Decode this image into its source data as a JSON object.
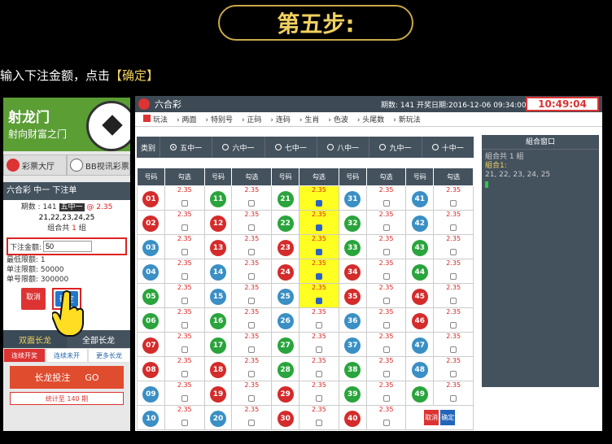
{
  "banner": {
    "title": "第五步:"
  },
  "instruction": {
    "prefix": "输入下注金额，点击",
    "highlight": "【确定】"
  },
  "left": {
    "brand": "射龙门",
    "slogan": "射向财富之门",
    "nav": [
      {
        "label": "彩票大厅"
      },
      {
        "label": "BB视讯彩票"
      }
    ],
    "bet_title": "六合彩 中一 下注单",
    "period_label": "期数 : 141",
    "tag": "五中一",
    "odds": "@ 2.35",
    "numbers": "21,22,23,24,25",
    "combo_prefix": "组合共",
    "combo_count": "1",
    "combo_suffix": "组",
    "amount_label": "下注金额:",
    "amount_value": "50",
    "min_bet": "最低限额: 1",
    "single_limit": "单注限额: 50000",
    "single_number_limit": "单号限额: 300000",
    "cancel": "取消",
    "confirm": "确定",
    "dragon_tabs": [
      "双面长龙",
      "全部长龙"
    ],
    "dragon_sub": [
      "连续开奖",
      "连续未开",
      "更多长龙"
    ],
    "dragon_bet": "长龙投注",
    "dragon_go": "GO",
    "stats": "统计至 140 期"
  },
  "main": {
    "title": "六合彩",
    "period": "期数: 141",
    "open_date": "开奖日期:2016-12-06 09:34:00",
    "timer": "10:49:04",
    "play_items": [
      "玩法",
      "两面",
      "特别号",
      "正码",
      "连码",
      "生肖",
      "色波",
      "头尾数",
      "新玩法"
    ],
    "category_label": "类别",
    "categories": [
      "五中一",
      "六中一",
      "七中一",
      "八中一",
      "九中一",
      "十中一"
    ],
    "col_num": "号码",
    "col_pick": "勾选",
    "odds": "2.35",
    "cancel": "取消",
    "confirm": "确定",
    "colors": {
      "red": "#d42b2b",
      "green": "#2aa43c",
      "blue": "#3a8fc4",
      "selected": "#ffff22"
    }
  },
  "combo": {
    "header": "組合窗口",
    "count_line": "組合共 1 組",
    "label": "組合1:",
    "numbers": "21, 22, 23, 24, 25"
  }
}
